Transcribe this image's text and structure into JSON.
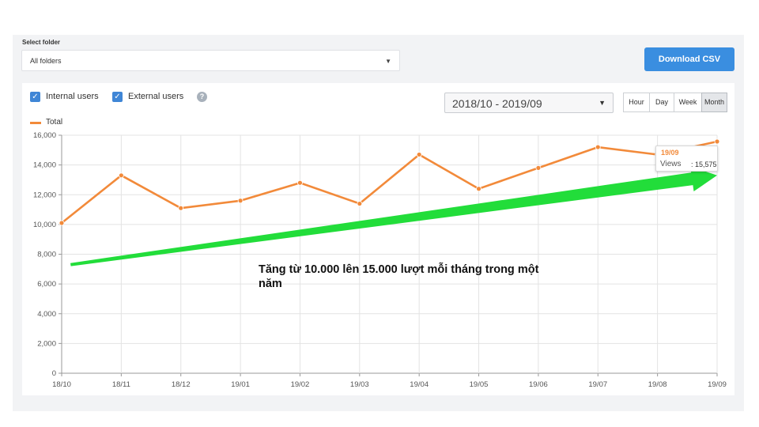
{
  "folder": {
    "label": "Select folder",
    "value": "All folders"
  },
  "download_button": "Download CSV",
  "filters": {
    "internal": "Internal users",
    "external": "External users",
    "help": "?"
  },
  "date_range": "2018/10 - 2019/09",
  "granularity": [
    "Hour",
    "Day",
    "Week",
    "Month"
  ],
  "granularity_selected": "Month",
  "tooltip": {
    "period": "19/09",
    "metric": "Views",
    "separator": " : ",
    "value": "15,575"
  },
  "annotation": "Tăng từ 10.000 lên 15.000 lượt mỗi tháng trong một năm",
  "colors": {
    "series": "#f28a3a",
    "arrow": "#22dd3a",
    "accent": "#3a8ee0"
  },
  "icons": {
    "checkbox": "check-icon",
    "dropdown": "chevron-down-icon",
    "help": "question-icon"
  },
  "chart_data": {
    "type": "line",
    "categories": [
      "18/10",
      "18/11",
      "18/12",
      "19/01",
      "19/02",
      "19/03",
      "19/04",
      "19/05",
      "19/06",
      "19/07",
      "19/08",
      "19/09"
    ],
    "series": [
      {
        "name": "Total",
        "values": [
          10100,
          13300,
          11100,
          11600,
          12800,
          11400,
          14700,
          12400,
          13800,
          15200,
          14700,
          15575
        ]
      }
    ],
    "y_ticks": [
      "0",
      "2,000",
      "4,000",
      "6,000",
      "8,000",
      "10,000",
      "12,000",
      "14,000",
      "16,000"
    ],
    "ylim": [
      0,
      16000
    ],
    "grid": true,
    "legend": "top-left",
    "trend_arrow": {
      "from": [
        0.15,
        7300
      ],
      "to": [
        11,
        13300
      ]
    }
  }
}
